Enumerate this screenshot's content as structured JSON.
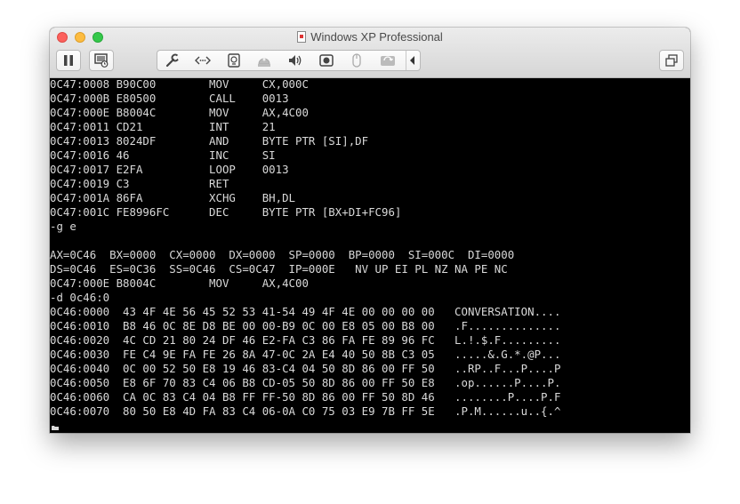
{
  "window": {
    "title": "Windows XP Professional",
    "colors": {
      "screen_bg": "#000000",
      "screen_fg": "#d9d9d9"
    }
  },
  "toolbar": {
    "left_buttons": [
      {
        "name": "pause-button",
        "icon": "pause-icon"
      },
      {
        "name": "snapshot-button",
        "icon": "snapshot-icon"
      }
    ],
    "segment_icons": [
      "wrench-icon",
      "network-icon",
      "hard-disk-icon",
      "cd-drive-icon",
      "sound-icon",
      "camera-icon",
      "usb-mouse-icon",
      "shared-folders-icon",
      "collapse-chevron-icon"
    ],
    "right_button_icon": "fullscreen-windows-icon"
  },
  "console": {
    "lines": [
      "0C47:0008 B90C00        MOV     CX,000C",
      "0C47:000B E80500        CALL    0013",
      "0C47:000E B8004C        MOV     AX,4C00",
      "0C47:0011 CD21          INT     21",
      "0C47:0013 8024DF        AND     BYTE PTR [SI],DF",
      "0C47:0016 46            INC     SI",
      "0C47:0017 E2FA          LOOP    0013",
      "0C47:0019 C3            RET",
      "0C47:001A 86FA          XCHG    BH,DL",
      "0C47:001C FE8996FC      DEC     BYTE PTR [BX+DI+FC96]",
      "-g e",
      "",
      "AX=0C46  BX=0000  CX=0000  DX=0000  SP=0000  BP=0000  SI=000C  DI=0000",
      "DS=0C46  ES=0C36  SS=0C46  CS=0C47  IP=000E   NV UP EI PL NZ NA PE NC",
      "0C47:000E B8004C        MOV     AX,4C00",
      "-d 0c46:0",
      "0C46:0000  43 4F 4E 56 45 52 53 41-54 49 4F 4E 00 00 00 00   CONVERSATION....",
      "0C46:0010  B8 46 0C 8E D8 BE 00 00-B9 0C 00 E8 05 00 B8 00   .F..............",
      "0C46:0020  4C CD 21 80 24 DF 46 E2-FA C3 86 FA FE 89 96 FC   L.!.$.F.........",
      "0C46:0030  FE C4 9E FA FE 26 8A 47-0C 2A E4 40 50 8B C3 05   .....&.G.*.@P...",
      "0C46:0040  0C 00 52 50 E8 19 46 83-C4 04 50 8D 86 00 FF 50   ..RP..F...P....P",
      "0C46:0050  E8 6F 70 83 C4 06 B8 CD-05 50 8D 86 00 FF 50 E8   .op......P....P.",
      "0C46:0060  CA 0C 83 C4 04 B8 FF FF-50 8D 86 00 FF 50 8D 46   ........P....P.F",
      "0C46:0070  80 50 E8 4D FA 83 C4 06-0A C0 75 03 E9 7B FF 5E   .P.M......u..{.^",
      "-"
    ]
  }
}
